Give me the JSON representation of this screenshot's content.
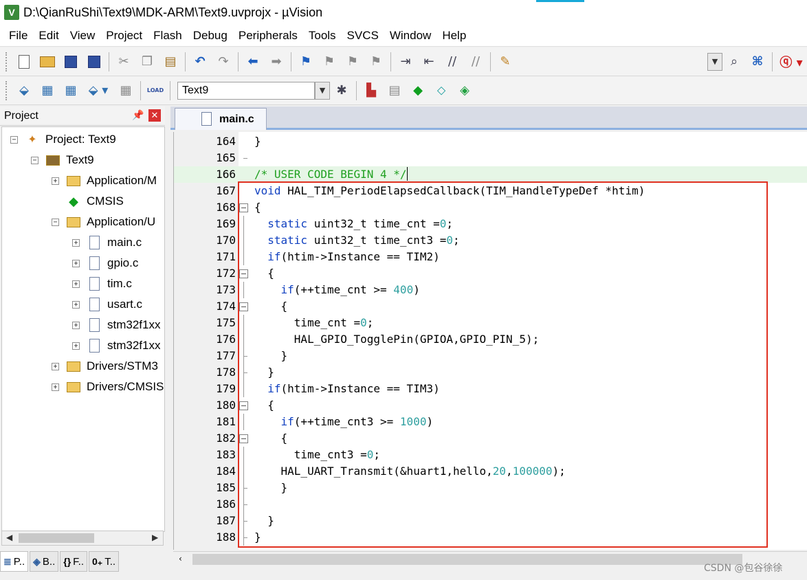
{
  "window": {
    "title": "D:\\QianRuShi\\Text9\\MDK-ARM\\Text9.uvprojx - µVision",
    "app_icon": "V"
  },
  "menu": [
    "File",
    "Edit",
    "View",
    "Project",
    "Flash",
    "Debug",
    "Peripherals",
    "Tools",
    "SVCS",
    "Window",
    "Help"
  ],
  "toolbar2": {
    "target": "Text9",
    "load_label": "LOAD"
  },
  "project_panel": {
    "title": "Project",
    "tree": [
      {
        "label": "Project: Text9",
        "expander": "−",
        "icon": "project-icon"
      },
      {
        "label": "Text9",
        "expander": "−",
        "icon": "target-icon"
      },
      {
        "label": "Application/M",
        "expander": "+",
        "icon": "folder-icon"
      },
      {
        "label": "CMSIS",
        "expander": "",
        "icon": "cmsis-icon"
      },
      {
        "label": "Application/U",
        "expander": "−",
        "icon": "folder-icon"
      },
      {
        "label": "main.c",
        "expander": "+",
        "icon": "file-icon"
      },
      {
        "label": "gpio.c",
        "expander": "+",
        "icon": "file-icon"
      },
      {
        "label": "tim.c",
        "expander": "+",
        "icon": "file-icon"
      },
      {
        "label": "usart.c",
        "expander": "+",
        "icon": "file-icon"
      },
      {
        "label": "stm32f1xx",
        "expander": "+",
        "icon": "file-icon"
      },
      {
        "label": "stm32f1xx",
        "expander": "+",
        "icon": "file-icon"
      },
      {
        "label": "Drivers/STM3",
        "expander": "+",
        "icon": "folder-icon"
      },
      {
        "label": "Drivers/CMSIS",
        "expander": "+",
        "icon": "folder-icon"
      }
    ],
    "bottom_tabs": [
      {
        "icon": "≣",
        "label": "P.."
      },
      {
        "icon": "◈",
        "label": "B.."
      },
      {
        "icon": "{}",
        "label": "F.."
      },
      {
        "icon": "0₊",
        "label": "T.."
      }
    ]
  },
  "editor": {
    "tab_label": "main.c",
    "lines": [
      {
        "n": "164",
        "code": "}"
      },
      {
        "n": "165",
        "code": ""
      },
      {
        "n": "166",
        "code": "/* USER CODE BEGIN 4 */"
      },
      {
        "n": "167",
        "code": "void HAL_TIM_PeriodElapsedCallback(TIM_HandleTypeDef *htim)"
      },
      {
        "n": "168",
        "code": "{"
      },
      {
        "n": "169",
        "code": "  static uint32_t time_cnt =0;"
      },
      {
        "n": "170",
        "code": "  static uint32_t time_cnt3 =0;"
      },
      {
        "n": "171",
        "code": "  if(htim->Instance == TIM2)"
      },
      {
        "n": "172",
        "code": "  {"
      },
      {
        "n": "173",
        "code": "    if(++time_cnt >= 400)"
      },
      {
        "n": "174",
        "code": "    {"
      },
      {
        "n": "175",
        "code": "      time_cnt =0;"
      },
      {
        "n": "176",
        "code": "      HAL_GPIO_TogglePin(GPIOA,GPIO_PIN_5);"
      },
      {
        "n": "177",
        "code": "    }"
      },
      {
        "n": "178",
        "code": "  }"
      },
      {
        "n": "179",
        "code": "  if(htim->Instance == TIM3)"
      },
      {
        "n": "180",
        "code": "  {"
      },
      {
        "n": "181",
        "code": "    if(++time_cnt3 >= 1000)"
      },
      {
        "n": "182",
        "code": "    {"
      },
      {
        "n": "183",
        "code": "      time_cnt3 =0;"
      },
      {
        "n": "184",
        "code": "    HAL_UART_Transmit(&huart1,hello,20,100000);"
      },
      {
        "n": "185",
        "code": "    }"
      },
      {
        "n": "186",
        "code": ""
      },
      {
        "n": "187",
        "code": "  }"
      },
      {
        "n": "188",
        "code": "}"
      }
    ]
  },
  "watermark": "CSDN @包谷徐徐"
}
